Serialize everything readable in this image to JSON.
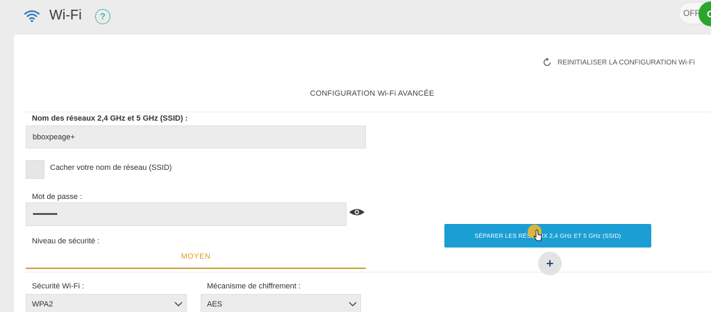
{
  "header": {
    "title": "Wi-Fi",
    "help_symbol": "?",
    "toggle": {
      "off_label": "OFF",
      "on_label": "O"
    }
  },
  "panel": {
    "reset_label": "REINITIALISER LA CONFIGURATION Wi-Fi",
    "section_title": "CONFIGURATION Wi-Fi AVANCÉE",
    "ssid": {
      "label": "Nom des réseaux 2,4 GHz et 5 GHz (SSID) :",
      "value": "bboxpeage+"
    },
    "hide_ssid": {
      "label": "Cacher votre nom de réseau (SSID)",
      "checked": false
    },
    "password": {
      "label": "Mot de passe :",
      "value": "••••••••••••••"
    },
    "security_level": {
      "label": "Niveau de sécurité :",
      "value": "MOYEN"
    },
    "wifi_security": {
      "label": "Sécurité Wi-Fi :",
      "selected": "WPA2"
    },
    "encryption": {
      "label": "Mécanisme de chiffrement :",
      "selected": "AES"
    },
    "split_button": {
      "label": "SÉPARER LES RÉSEAUX 2,4 GHz ET 5 GHz (SSID)"
    },
    "add_symbol": "+"
  },
  "colors": {
    "accent_blue": "#1b9ed4",
    "toggle_green": "#2ca52c",
    "level_gold": "#e0a020",
    "help_teal": "#4ab5a8"
  },
  "icons": [
    "wifi-icon",
    "help-icon",
    "refresh-icon",
    "eye-icon",
    "chevron-down-icon",
    "plus-icon",
    "cursor-icon"
  ]
}
